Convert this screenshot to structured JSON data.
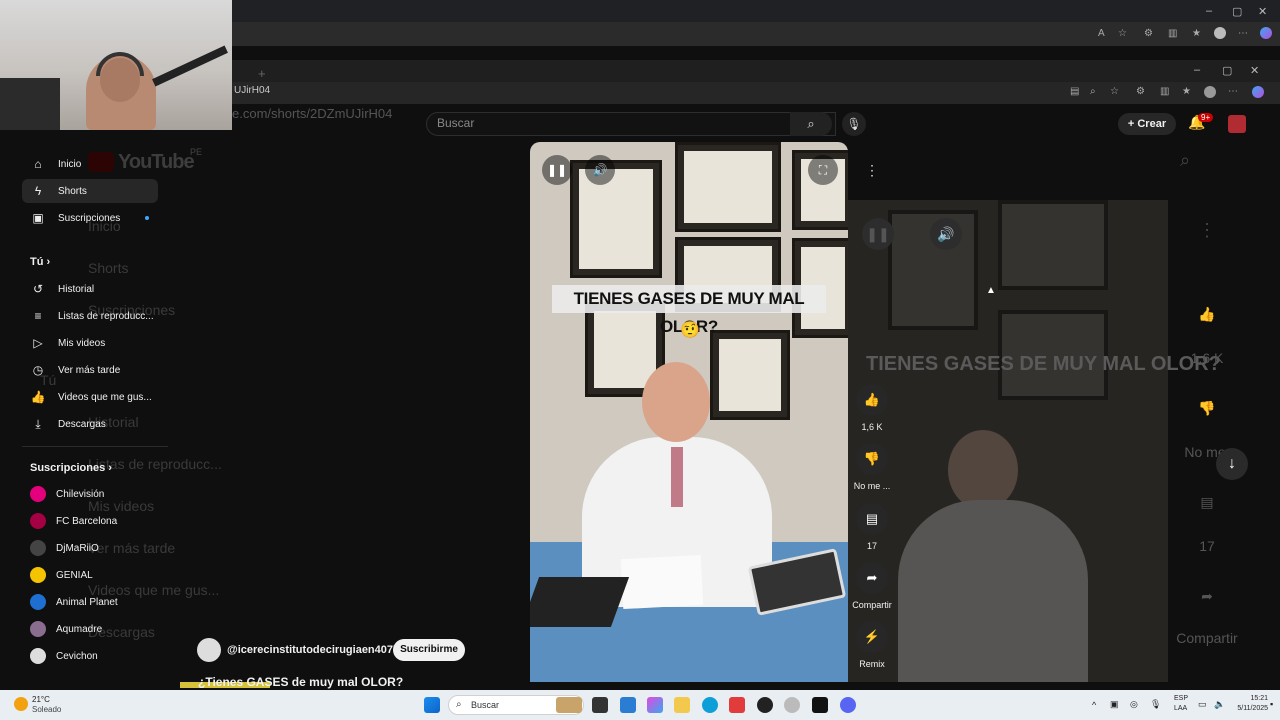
{
  "outer_browser": {
    "window_controls": [
      "–",
      "▢",
      "✕"
    ]
  },
  "inner_browser": {
    "url": "UJirH04",
    "window_controls": [
      "–",
      "▢",
      "✕"
    ],
    "ghost_url": "e.com/shorts/2DZmUJirH04"
  },
  "youtube_header": {
    "logo_text": "YouTube",
    "country": "PE",
    "search_placeholder": "Buscar",
    "create_label": "Crear",
    "notification_badge": "9+"
  },
  "sidebar": {
    "items": [
      {
        "label": "Inicio",
        "icon": "home-icon"
      },
      {
        "label": "Shorts",
        "icon": "shorts-icon"
      },
      {
        "label": "Suscripciones",
        "icon": "subscriptions-icon"
      }
    ],
    "tu_label": "Tú",
    "you_items": [
      {
        "label": "Historial",
        "icon": "history-icon"
      },
      {
        "label": "Listas de reproducc...",
        "icon": "playlist-icon"
      },
      {
        "label": "Mis videos",
        "icon": "video-icon"
      },
      {
        "label": "Ver más tarde",
        "icon": "clock-icon"
      },
      {
        "label": "Videos que me gus...",
        "icon": "thumbs-up-icon"
      },
      {
        "label": "Descargas",
        "icon": "download-icon"
      }
    ],
    "subs_label": "Suscripciones",
    "subscriptions": [
      {
        "label": "Chilevisión",
        "color": "#e4007c"
      },
      {
        "label": "FC Barcelona",
        "color": "#a50044"
      },
      {
        "label": "DjMaRiiO",
        "color": "#444444"
      },
      {
        "label": "GENIAL",
        "color": "#f5c400"
      },
      {
        "label": "Animal Planet",
        "color": "#1f6fd1"
      },
      {
        "label": "Aqumadre",
        "color": "#8a6d8f"
      },
      {
        "label": "Cevichon",
        "color": "#dddddd"
      }
    ]
  },
  "ghost_sidebar": [
    "Inicio",
    "Shorts",
    "Suscripciones",
    "Tú",
    "Historial",
    "Listas de reproducc...",
    "Mis videos",
    "Ver más tarde",
    "Videos que me gus...",
    "Descargas"
  ],
  "video": {
    "caption": "TIENES GASES DE MUY MAL OLOR?",
    "emoji": "🤨"
  },
  "actions": {
    "likes": "1,6 K",
    "dislike": "No me ...",
    "comments": "17",
    "share": "Compartir",
    "remix": "Remix"
  },
  "ghost_actions": {
    "likes": "1,6 K",
    "dislike": "No me",
    "comments": "17",
    "share": "Compartir",
    "caption": "TIENES GASES DE MUY MAL OLOR?"
  },
  "channel": {
    "name": "@icerecinstitutodecirugiaen4077",
    "subscribe": "Suscribirme",
    "title": "¿Tienes GASES de muy mal OLOR?"
  },
  "taskbar": {
    "weather_temp": "21°C",
    "weather_cond": "Soleado",
    "search": "Buscar",
    "lang": "ESP",
    "lang2": "LAA",
    "time": "15:21",
    "date": "5/11/2025"
  }
}
